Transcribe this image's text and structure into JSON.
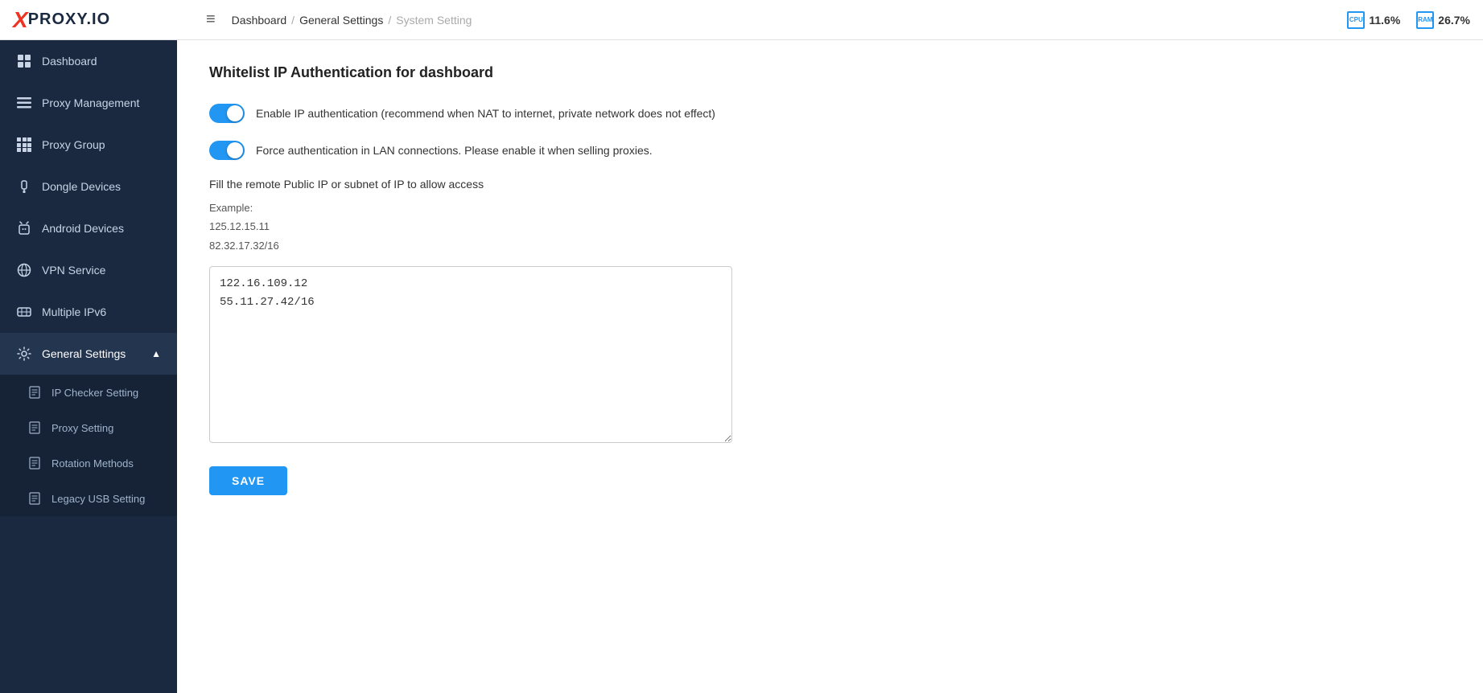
{
  "logo": {
    "x": "X",
    "text": "PROXY.IO"
  },
  "header": {
    "hamburger_icon": "≡",
    "breadcrumb": {
      "dashboard": "Dashboard",
      "general_settings": "General Settings",
      "system_setting": "System Setting"
    },
    "cpu_label": "CPU",
    "cpu_value": "11.6%",
    "ram_label": "RAM",
    "ram_value": "26.7%"
  },
  "sidebar": {
    "items": [
      {
        "id": "dashboard",
        "label": "Dashboard",
        "icon": "grid"
      },
      {
        "id": "proxy-management",
        "label": "Proxy Management",
        "icon": "list"
      },
      {
        "id": "proxy-group",
        "label": "Proxy Group",
        "icon": "apps"
      },
      {
        "id": "dongle-devices",
        "label": "Dongle Devices",
        "icon": "devices"
      },
      {
        "id": "android-devices",
        "label": "Android Devices",
        "icon": "android"
      },
      {
        "id": "vpn-service",
        "label": "VPN Service",
        "icon": "vpn"
      },
      {
        "id": "multiple-ipv6",
        "label": "Multiple IPv6",
        "icon": "ipv6"
      },
      {
        "id": "general-settings",
        "label": "General Settings",
        "icon": "settings",
        "expanded": true
      }
    ],
    "sub_items": [
      {
        "id": "ip-checker-setting",
        "label": "IP Checker Setting",
        "icon": "doc"
      },
      {
        "id": "proxy-setting",
        "label": "Proxy Setting",
        "icon": "doc"
      },
      {
        "id": "rotation-methods",
        "label": "Rotation Methods",
        "icon": "doc"
      },
      {
        "id": "legacy-usb-setting",
        "label": "Legacy USB Setting",
        "icon": "doc"
      }
    ]
  },
  "main": {
    "section_title": "Whitelist IP Authentication for dashboard",
    "toggle1": {
      "enabled": true,
      "label": "Enable IP authentication (recommend when NAT to internet, private network does not effect)"
    },
    "toggle2": {
      "enabled": true,
      "label": "Force authentication in LAN connections. Please enable it when selling proxies."
    },
    "fill_label": "Fill the remote Public IP or subnet of IP to allow access",
    "example_label": "Example:",
    "example_ips": "125.12.15.11\n82.32.17.32/16",
    "textarea_value": "122.16.109.12\n55.11.27.42/16",
    "save_button": "SAVE"
  }
}
